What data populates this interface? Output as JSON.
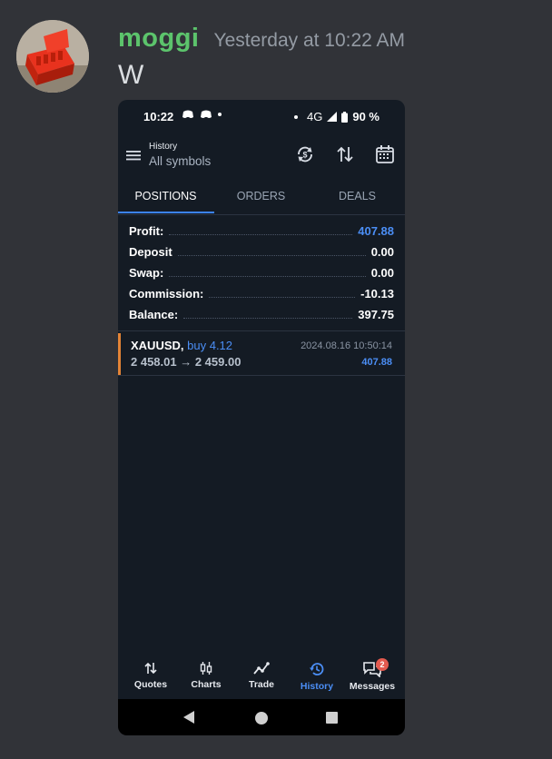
{
  "message": {
    "username": "moggi",
    "timestamp": "Yesterday at 10:22 AM",
    "text": "W"
  },
  "phone": {
    "status_bar": {
      "time": "10:22",
      "network": "4G",
      "battery": "90 %"
    },
    "app_bar": {
      "title": "History",
      "subtitle": "All symbols"
    },
    "tabs": [
      {
        "label": "POSITIONS",
        "active": true
      },
      {
        "label": "ORDERS",
        "active": false
      },
      {
        "label": "DEALS",
        "active": false
      }
    ],
    "summary": [
      {
        "label": "Profit:",
        "value": "407.88"
      },
      {
        "label": "Deposit",
        "value": "0.00"
      },
      {
        "label": "Swap:",
        "value": "0.00"
      },
      {
        "label": "Commission:",
        "value": "-10.13"
      },
      {
        "label": "Balance:",
        "value": "397.75"
      }
    ],
    "position": {
      "symbol": "XAUUSD,",
      "side": "buy 4.12",
      "prices": "2 458.01 → 2 459.00",
      "time": "2024.08.16 10:50:14",
      "profit": "407.88"
    },
    "bottom_nav": [
      {
        "label": "Quotes",
        "icon": "quotes-icon"
      },
      {
        "label": "Charts",
        "icon": "charts-icon"
      },
      {
        "label": "Trade",
        "icon": "trade-icon"
      },
      {
        "label": "History",
        "icon": "history-icon",
        "active": true
      },
      {
        "label": "Messages",
        "icon": "messages-icon",
        "badge": "2"
      }
    ]
  },
  "colors": {
    "username": "#5cc46c",
    "accent": "#4b8ef5",
    "position_bar": "#e38436",
    "badge": "#e35a4f"
  }
}
